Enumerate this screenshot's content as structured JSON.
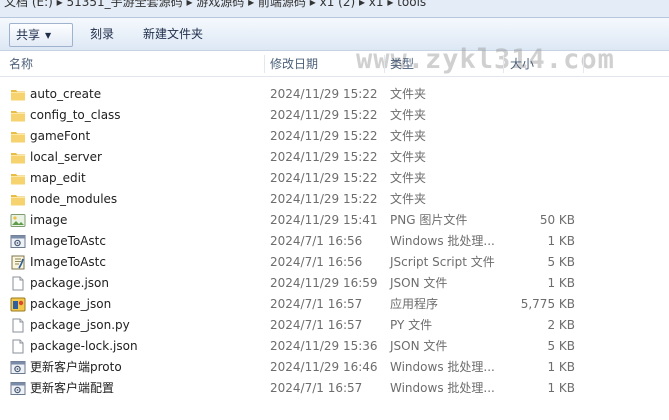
{
  "address": {
    "path_text": "文档 (E:) ▸ 51351_手游全套源码 ▸ 游戏源码 ▸ 前端源码 ▸ x1 (2) ▸ x1 ▸ tools"
  },
  "toolbar": {
    "share_label": "共享",
    "burn_label": "刻录",
    "new_folder_label": "新建文件夹"
  },
  "watermark": "www.zykl314.com",
  "columns": {
    "name": "名称",
    "date": "修改日期",
    "type": "类型",
    "size": "大小"
  },
  "files": [
    {
      "name": "auto_create",
      "date": "2024/11/29 15:22",
      "type": "文件夹",
      "size": "",
      "icon": "folder-icon"
    },
    {
      "name": "config_to_class",
      "date": "2024/11/29 15:22",
      "type": "文件夹",
      "size": "",
      "icon": "folder-icon"
    },
    {
      "name": "gameFont",
      "date": "2024/11/29 15:22",
      "type": "文件夹",
      "size": "",
      "icon": "folder-icon"
    },
    {
      "name": "local_server",
      "date": "2024/11/29 15:22",
      "type": "文件夹",
      "size": "",
      "icon": "folder-icon"
    },
    {
      "name": "map_edit",
      "date": "2024/11/29 15:22",
      "type": "文件夹",
      "size": "",
      "icon": "folder-icon"
    },
    {
      "name": "node_modules",
      "date": "2024/11/29 15:22",
      "type": "文件夹",
      "size": "",
      "icon": "folder-icon"
    },
    {
      "name": "image",
      "date": "2024/11/29 15:41",
      "type": "PNG 图片文件",
      "size": "50 KB",
      "icon": "image-file-icon"
    },
    {
      "name": "ImageToAstc",
      "date": "2024/7/1 16:56",
      "type": "Windows 批处理...",
      "size": "1 KB",
      "icon": "batch-file-icon"
    },
    {
      "name": "ImageToAstc",
      "date": "2024/7/1 16:56",
      "type": "JScript Script 文件",
      "size": "5 KB",
      "icon": "script-file-icon"
    },
    {
      "name": "package.json",
      "date": "2024/11/29 16:59",
      "type": "JSON 文件",
      "size": "1 KB",
      "icon": "document-icon"
    },
    {
      "name": "package_json",
      "date": "2024/7/1 16:57",
      "type": "应用程序",
      "size": "5,775 KB",
      "icon": "application-icon"
    },
    {
      "name": "package_json.py",
      "date": "2024/7/1 16:57",
      "type": "PY 文件",
      "size": "2 KB",
      "icon": "document-icon"
    },
    {
      "name": "package-lock.json",
      "date": "2024/11/29 15:36",
      "type": "JSON 文件",
      "size": "5 KB",
      "icon": "document-icon"
    },
    {
      "name": "更新客户端proto",
      "date": "2024/11/29 16:46",
      "type": "Windows 批处理...",
      "size": "1 KB",
      "icon": "batch-file-icon"
    },
    {
      "name": "更新客户端配置",
      "date": "2024/7/1 16:57",
      "type": "Windows 批处理...",
      "size": "1 KB",
      "icon": "batch-file-icon"
    }
  ]
}
